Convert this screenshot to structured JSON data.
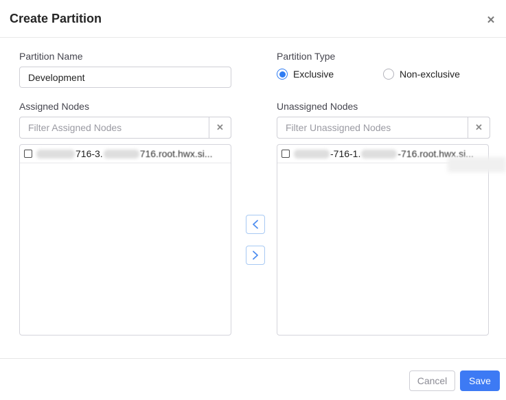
{
  "dialog": {
    "title": "Create Partition",
    "close_icon": "✕"
  },
  "form": {
    "partition_name": {
      "label": "Partition Name",
      "value": "Development"
    },
    "partition_type": {
      "label": "Partition Type",
      "options": [
        {
          "label": "Exclusive",
          "selected": true
        },
        {
          "label": "Non-exclusive",
          "selected": false
        }
      ]
    }
  },
  "assigned": {
    "label": "Assigned Nodes",
    "filter": {
      "placeholder": "Filter Assigned Nodes",
      "value": "",
      "clear_icon": "✕"
    },
    "items": [
      {
        "checked": false,
        "redacted": true,
        "part1": "716-3.",
        "part2": "716.root.hwx.si..."
      }
    ]
  },
  "unassigned": {
    "label": "Unassigned Nodes",
    "filter": {
      "placeholder": "Filter Unassigned Nodes",
      "value": "",
      "clear_icon": "✕"
    },
    "items": [
      {
        "checked": false,
        "redacted": true,
        "part1": "-716-1.",
        "part2": "-716.root.hwx.si..."
      }
    ]
  },
  "transfer": {
    "move_left_icon": "chevron-left",
    "move_right_icon": "chevron-right"
  },
  "footer": {
    "cancel_label": "Cancel",
    "save_label": "Save"
  },
  "colors": {
    "accent": "#2e7cf3",
    "save_bg": "#3d7af4",
    "border": "#cfcfd6"
  }
}
